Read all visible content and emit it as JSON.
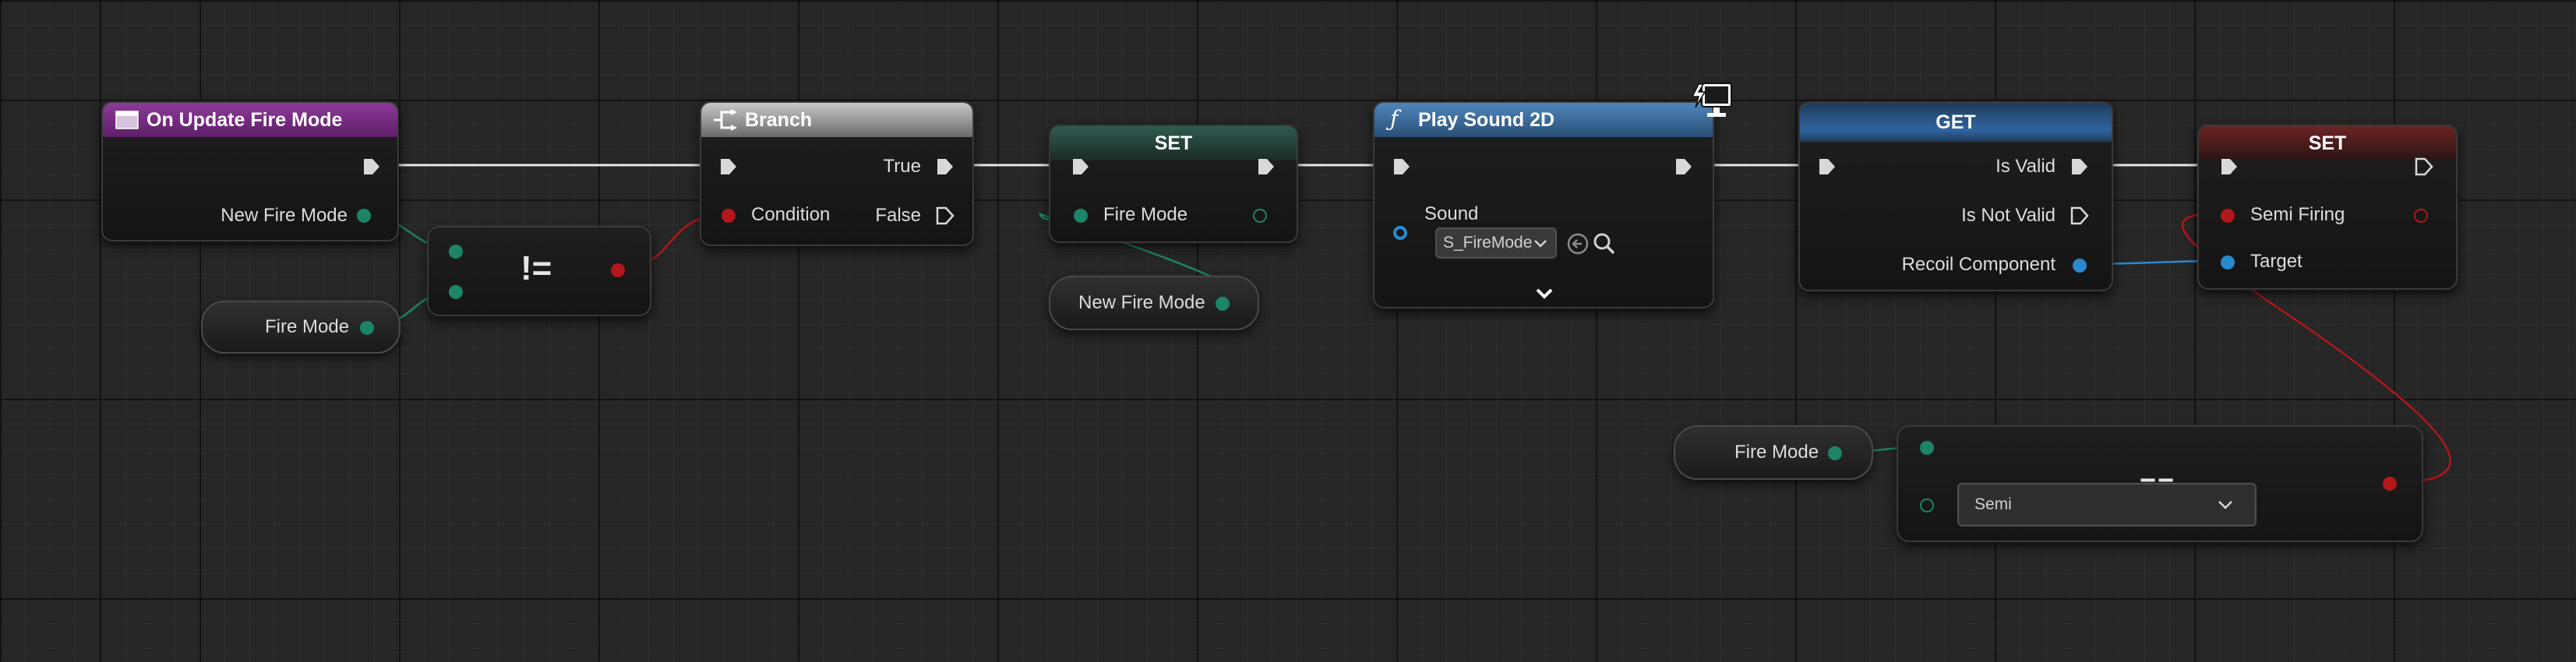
{
  "colors": {
    "background": "#262626",
    "exec_wire": "#e8e8e8",
    "fire_mode_pin": "#1d8468",
    "boolean_pin": "#b2171b",
    "object_pin": "#2a8ad0",
    "event_header": "#7a2d86",
    "function_header": "#3d6c9c",
    "get_header": "#2b4e77",
    "set_red_header": "#6a2222",
    "set_teal_header": "#244a41"
  },
  "nodes": {
    "on_update": {
      "title": "On Update Fire Mode",
      "icon": "event-icon",
      "output_label": "New Fire Mode"
    },
    "not_equal": {
      "operator": "!="
    },
    "fire_mode_var_left": {
      "label": "Fire Mode"
    },
    "branch": {
      "title": "Branch",
      "icon": "branch-icon",
      "condition_label": "Condition",
      "true_label": "True",
      "false_label": "False"
    },
    "set_fire_mode": {
      "title": "SET",
      "pin_label": "Fire Mode"
    },
    "new_fire_mode_var": {
      "label": "New Fire Mode"
    },
    "play_sound": {
      "title": "Play Sound 2D",
      "icon": "function-icon",
      "corner_icon": "client-only-icon",
      "sound_label": "Sound",
      "sound_value": "S_FireMode",
      "expand_icon": "chevron-down-icon"
    },
    "get_recoil": {
      "title": "GET",
      "is_valid_label": "Is Valid",
      "is_not_valid_label": "Is Not Valid",
      "input_label": "Recoil Component"
    },
    "set_semi": {
      "title": "SET",
      "semi_firing_label": "Semi Firing",
      "target_label": "Target"
    },
    "fire_mode_var_right": {
      "label": "Fire Mode"
    },
    "enum_equal": {
      "operator": "==",
      "selected_value": "Semi"
    }
  }
}
